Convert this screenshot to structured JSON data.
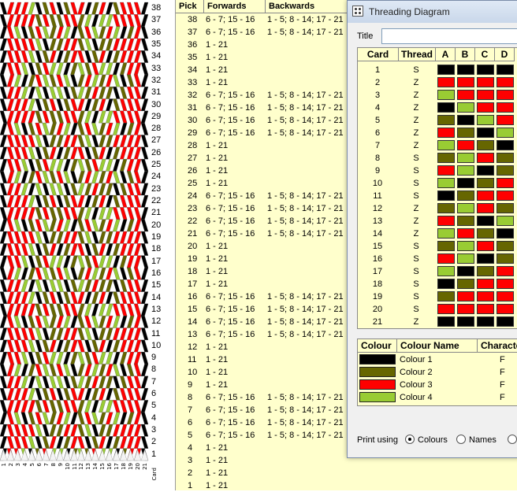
{
  "pattern": {
    "cards": 21,
    "picks": 38,
    "colours": [
      "#000000",
      "#666600",
      "#ff0000",
      "#99cc33"
    ],
    "card_label": "Card",
    "column_labels": [
      "1",
      "2",
      "3",
      "4",
      "5",
      "6",
      "7",
      "8",
      "9",
      "10",
      "11",
      "12",
      "13",
      "14",
      "15",
      "16",
      "17",
      "18",
      "19",
      "20",
      "21"
    ],
    "row_labels": [
      "38",
      "37",
      "36",
      "35",
      "34",
      "33",
      "32",
      "31",
      "30",
      "29",
      "28",
      "27",
      "26",
      "25",
      "24",
      "23",
      "22",
      "21",
      "20",
      "19",
      "18",
      "17",
      "16",
      "15",
      "14",
      "13",
      "12",
      "11",
      "10",
      "9",
      "8",
      "7",
      "6",
      "5",
      "4",
      "3",
      "2",
      "1"
    ]
  },
  "pick_table": {
    "headers": {
      "pick": "Pick",
      "forwards": "Forwards",
      "backwards": "Backwards"
    },
    "rows": [
      {
        "pick": "38",
        "forwards": "6 - 7; 15 - 16",
        "backwards": "1 - 5; 8 - 14; 17 - 21"
      },
      {
        "pick": "37",
        "forwards": "6 - 7; 15 - 16",
        "backwards": "1 - 5; 8 - 14; 17 - 21"
      },
      {
        "pick": "36",
        "forwards": "1 - 21",
        "backwards": ""
      },
      {
        "pick": "35",
        "forwards": "1 - 21",
        "backwards": ""
      },
      {
        "pick": "34",
        "forwards": "1 - 21",
        "backwards": ""
      },
      {
        "pick": "33",
        "forwards": "1 - 21",
        "backwards": ""
      },
      {
        "pick": "32",
        "forwards": "6 - 7; 15 - 16",
        "backwards": "1 - 5; 8 - 14; 17 - 21"
      },
      {
        "pick": "31",
        "forwards": "6 - 7; 15 - 16",
        "backwards": "1 - 5; 8 - 14; 17 - 21"
      },
      {
        "pick": "30",
        "forwards": "6 - 7; 15 - 16",
        "backwards": "1 - 5; 8 - 14; 17 - 21"
      },
      {
        "pick": "29",
        "forwards": "6 - 7; 15 - 16",
        "backwards": "1 - 5; 8 - 14; 17 - 21"
      },
      {
        "pick": "28",
        "forwards": "1 - 21",
        "backwards": ""
      },
      {
        "pick": "27",
        "forwards": "1 - 21",
        "backwards": ""
      },
      {
        "pick": "26",
        "forwards": "1 - 21",
        "backwards": ""
      },
      {
        "pick": "25",
        "forwards": "1 - 21",
        "backwards": ""
      },
      {
        "pick": "24",
        "forwards": "6 - 7; 15 - 16",
        "backwards": "1 - 5; 8 - 14; 17 - 21"
      },
      {
        "pick": "23",
        "forwards": "6 - 7; 15 - 16",
        "backwards": "1 - 5; 8 - 14; 17 - 21"
      },
      {
        "pick": "22",
        "forwards": "6 - 7; 15 - 16",
        "backwards": "1 - 5; 8 - 14; 17 - 21"
      },
      {
        "pick": "21",
        "forwards": "6 - 7; 15 - 16",
        "backwards": "1 - 5; 8 - 14; 17 - 21"
      },
      {
        "pick": "20",
        "forwards": "1 - 21",
        "backwards": ""
      },
      {
        "pick": "19",
        "forwards": "1 - 21",
        "backwards": ""
      },
      {
        "pick": "18",
        "forwards": "1 - 21",
        "backwards": ""
      },
      {
        "pick": "17",
        "forwards": "1 - 21",
        "backwards": ""
      },
      {
        "pick": "16",
        "forwards": "6 - 7; 15 - 16",
        "backwards": "1 - 5; 8 - 14; 17 - 21"
      },
      {
        "pick": "15",
        "forwards": "6 - 7; 15 - 16",
        "backwards": "1 - 5; 8 - 14; 17 - 21"
      },
      {
        "pick": "14",
        "forwards": "6 - 7; 15 - 16",
        "backwards": "1 - 5; 8 - 14; 17 - 21"
      },
      {
        "pick": "13",
        "forwards": "6 - 7; 15 - 16",
        "backwards": "1 - 5; 8 - 14; 17 - 21"
      },
      {
        "pick": "12",
        "forwards": "1 - 21",
        "backwards": ""
      },
      {
        "pick": "11",
        "forwards": "1 - 21",
        "backwards": ""
      },
      {
        "pick": "10",
        "forwards": "1 - 21",
        "backwards": ""
      },
      {
        "pick": "9",
        "forwards": "1 - 21",
        "backwards": ""
      },
      {
        "pick": "8",
        "forwards": "6 - 7; 15 - 16",
        "backwards": "1 - 5; 8 - 14; 17 - 21"
      },
      {
        "pick": "7",
        "forwards": "6 - 7; 15 - 16",
        "backwards": "1 - 5; 8 - 14; 17 - 21"
      },
      {
        "pick": "6",
        "forwards": "6 - 7; 15 - 16",
        "backwards": "1 - 5; 8 - 14; 17 - 21"
      },
      {
        "pick": "5",
        "forwards": "6 - 7; 15 - 16",
        "backwards": "1 - 5; 8 - 14; 17 - 21"
      },
      {
        "pick": "4",
        "forwards": "1 - 21",
        "backwards": ""
      },
      {
        "pick": "3",
        "forwards": "1 - 21",
        "backwards": ""
      },
      {
        "pick": "2",
        "forwards": "1 - 21",
        "backwards": ""
      },
      {
        "pick": "1",
        "forwards": "1 - 21",
        "backwards": ""
      }
    ]
  },
  "threading_window": {
    "title": "Threading Diagram",
    "title_label": "Title",
    "title_value": "",
    "headers": {
      "card": "Card",
      "thread": "Thread",
      "holes": [
        "A",
        "B",
        "C",
        "D"
      ]
    },
    "cards": [
      {
        "card": "1",
        "thread": "S",
        "holes": [
          0,
          0,
          0,
          0
        ]
      },
      {
        "card": "2",
        "thread": "Z",
        "holes": [
          2,
          2,
          2,
          2
        ]
      },
      {
        "card": "3",
        "thread": "Z",
        "holes": [
          3,
          2,
          2,
          2
        ]
      },
      {
        "card": "4",
        "thread": "Z",
        "holes": [
          0,
          3,
          2,
          2
        ]
      },
      {
        "card": "5",
        "thread": "Z",
        "holes": [
          1,
          0,
          3,
          2
        ]
      },
      {
        "card": "6",
        "thread": "Z",
        "holes": [
          2,
          1,
          0,
          3
        ]
      },
      {
        "card": "7",
        "thread": "Z",
        "holes": [
          3,
          2,
          1,
          0
        ]
      },
      {
        "card": "8",
        "thread": "S",
        "holes": [
          1,
          3,
          2,
          1
        ]
      },
      {
        "card": "9",
        "thread": "S",
        "holes": [
          2,
          3,
          0,
          1
        ]
      },
      {
        "card": "10",
        "thread": "S",
        "holes": [
          3,
          0,
          1,
          2
        ]
      },
      {
        "card": "11",
        "thread": "S",
        "holes": [
          0,
          1,
          2,
          2
        ]
      },
      {
        "card": "12",
        "thread": "Z",
        "holes": [
          1,
          3,
          2,
          1
        ]
      },
      {
        "card": "13",
        "thread": "Z",
        "holes": [
          2,
          1,
          0,
          3
        ]
      },
      {
        "card": "14",
        "thread": "Z",
        "holes": [
          3,
          2,
          1,
          0
        ]
      },
      {
        "card": "15",
        "thread": "S",
        "holes": [
          1,
          3,
          2,
          1
        ]
      },
      {
        "card": "16",
        "thread": "S",
        "holes": [
          2,
          3,
          0,
          1
        ]
      },
      {
        "card": "17",
        "thread": "S",
        "holes": [
          3,
          0,
          1,
          2
        ]
      },
      {
        "card": "18",
        "thread": "S",
        "holes": [
          0,
          1,
          2,
          2
        ]
      },
      {
        "card": "19",
        "thread": "S",
        "holes": [
          1,
          2,
          2,
          2
        ]
      },
      {
        "card": "20",
        "thread": "S",
        "holes": [
          2,
          2,
          2,
          2
        ]
      },
      {
        "card": "21",
        "thread": "Z",
        "holes": [
          0,
          0,
          0,
          0
        ]
      }
    ],
    "colour_headers": {
      "colour": "Colour",
      "name": "Colour Name",
      "character": "Characte"
    },
    "colours": [
      {
        "name": "Colour 1",
        "hex": "#000000",
        "character": "F"
      },
      {
        "name": "Colour 2",
        "hex": "#666600",
        "character": "F"
      },
      {
        "name": "Colour 3",
        "hex": "#ff0000",
        "character": "F"
      },
      {
        "name": "Colour 4",
        "hex": "#99cc33",
        "character": "F"
      }
    ],
    "print_label": "Print using",
    "print_options": [
      "Colours",
      "Names"
    ],
    "print_selected": "Colours"
  }
}
